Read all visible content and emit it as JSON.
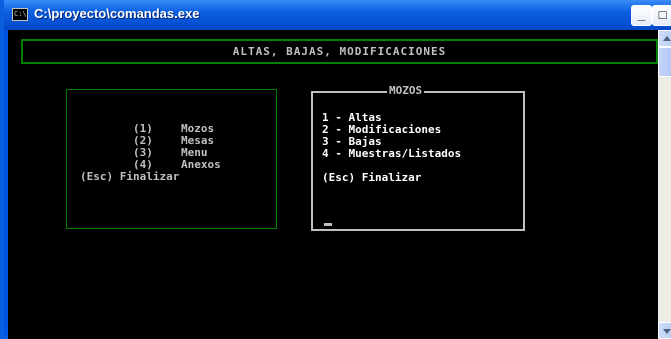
{
  "window": {
    "title": "C:\\proyecto\\comandas.exe",
    "icon_text": "C:\\",
    "buttons": {
      "minimize": "_",
      "maximize": "□",
      "close": "×"
    }
  },
  "console": {
    "header": "ALTAS, BAJAS, MODIFICACIONES",
    "main_menu": {
      "items": [
        {
          "key": "(1)",
          "label": "Mozos"
        },
        {
          "key": "(2)",
          "label": "Mesas"
        },
        {
          "key": "(3)",
          "label": "Menu"
        },
        {
          "key": "(4)",
          "label": "Anexos"
        }
      ],
      "exit": "(Esc) Finalizar"
    },
    "submenu": {
      "title": "MOZOS",
      "items": [
        "1 - Altas",
        "2 - Modificaciones",
        "3 - Bajas",
        "4 - Muestras/Listados"
      ],
      "exit": "(Esc) Finalizar"
    }
  },
  "colors": {
    "console_bg": "#000000",
    "console_text": "#c0c0c0",
    "border_green": "#008000",
    "titlebar_blue": "#0a5fe0"
  }
}
